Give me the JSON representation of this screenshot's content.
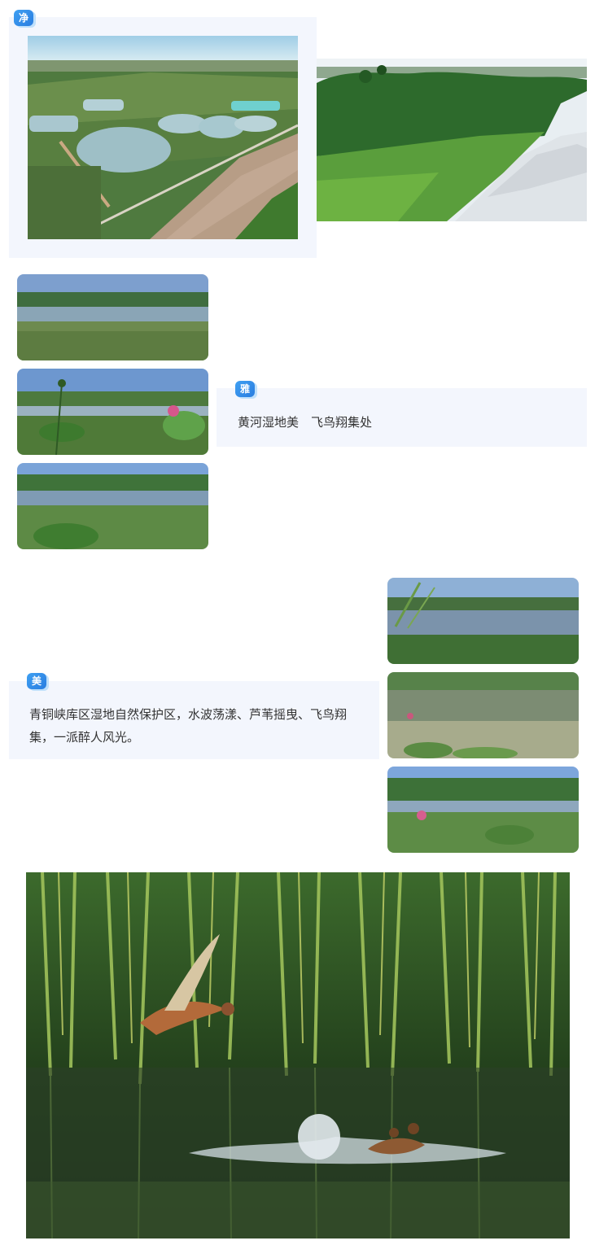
{
  "sections": {
    "jing": {
      "badge": "净"
    },
    "ya": {
      "badge": "雅",
      "caption": "黄河湿地美　飞鸟翔集处"
    },
    "mei": {
      "badge": "美",
      "caption": "青铜峡库区湿地自然保护区，水波荡漾、芦苇摇曳、飞鸟翔集，一派醉人风光。"
    }
  },
  "photos": {
    "aerial": "aerial-wetland-ponds-photo",
    "river": "river-bank-egrets-photo",
    "ya_1": "wetland-lake-photo",
    "ya_2": "lotus-pond-photo",
    "ya_3": "lotus-leaves-lake-photo",
    "mei_1": "reed-lake-photo",
    "mei_2": "reflection-pond-photo",
    "mei_3": "lotus-field-photo",
    "ducks": "ducks-in-reeds-photo"
  },
  "colors": {
    "panel_bg": "#f3f6fd",
    "badge_blue": "#2a7de0",
    "text": "#333333"
  }
}
